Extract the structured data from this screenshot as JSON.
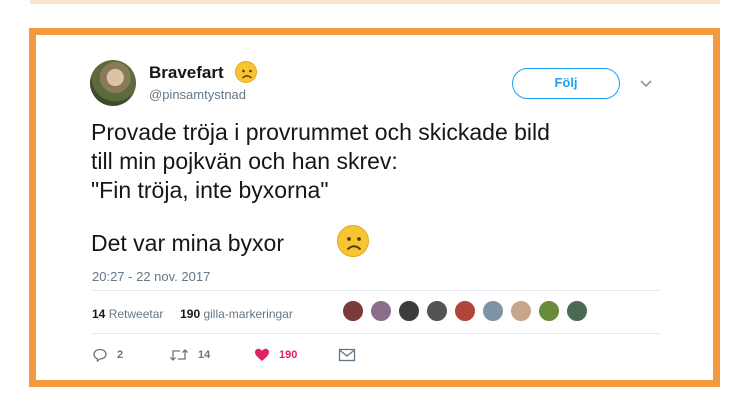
{
  "tweet": {
    "display_name": "Bravefart",
    "name_emoji": "frowning-face",
    "handle": "@pinsamtystnad",
    "follow_label": "Följ",
    "text_main": "Provade tröja i provrummet och skickade bild\ntill min pojkvän och han skrev:\n\"Fin tröja, inte byxorna\"",
    "text_second": "Det var mina byxor",
    "text_emoji": "frowning-face",
    "timestamp": "20:27 - 22 nov. 2017"
  },
  "stats": {
    "retweets_count": "14",
    "retweets_label": "Retweetar",
    "likes_count": "190",
    "likes_label": "gilla-markeringar"
  },
  "actions": {
    "reply_count": "2",
    "retweet_count": "14",
    "like_count": "190"
  },
  "colors": {
    "frame": "#f39a3f",
    "accent_blue": "#1da1f2",
    "like_red": "#e0245e",
    "muted": "#657786"
  }
}
